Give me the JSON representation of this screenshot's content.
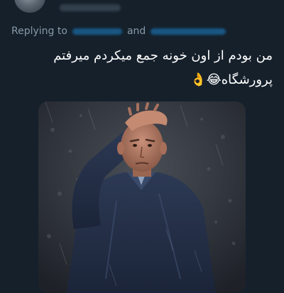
{
  "header": {
    "avatar_icon": "user-avatar-icon"
  },
  "reply": {
    "prefix": "Replying to",
    "conjunction": "and"
  },
  "tweet": {
    "line1": "من بودم از اون خونه جمع میکردم میرفتم",
    "line2": "پرورشگاه😂👌"
  },
  "media": {
    "icon": "photo-football-coach-hand-on-head"
  },
  "colors": {
    "background": "#15202b",
    "secondary_text": "#8899a6",
    "link": "#1d9bf0"
  }
}
